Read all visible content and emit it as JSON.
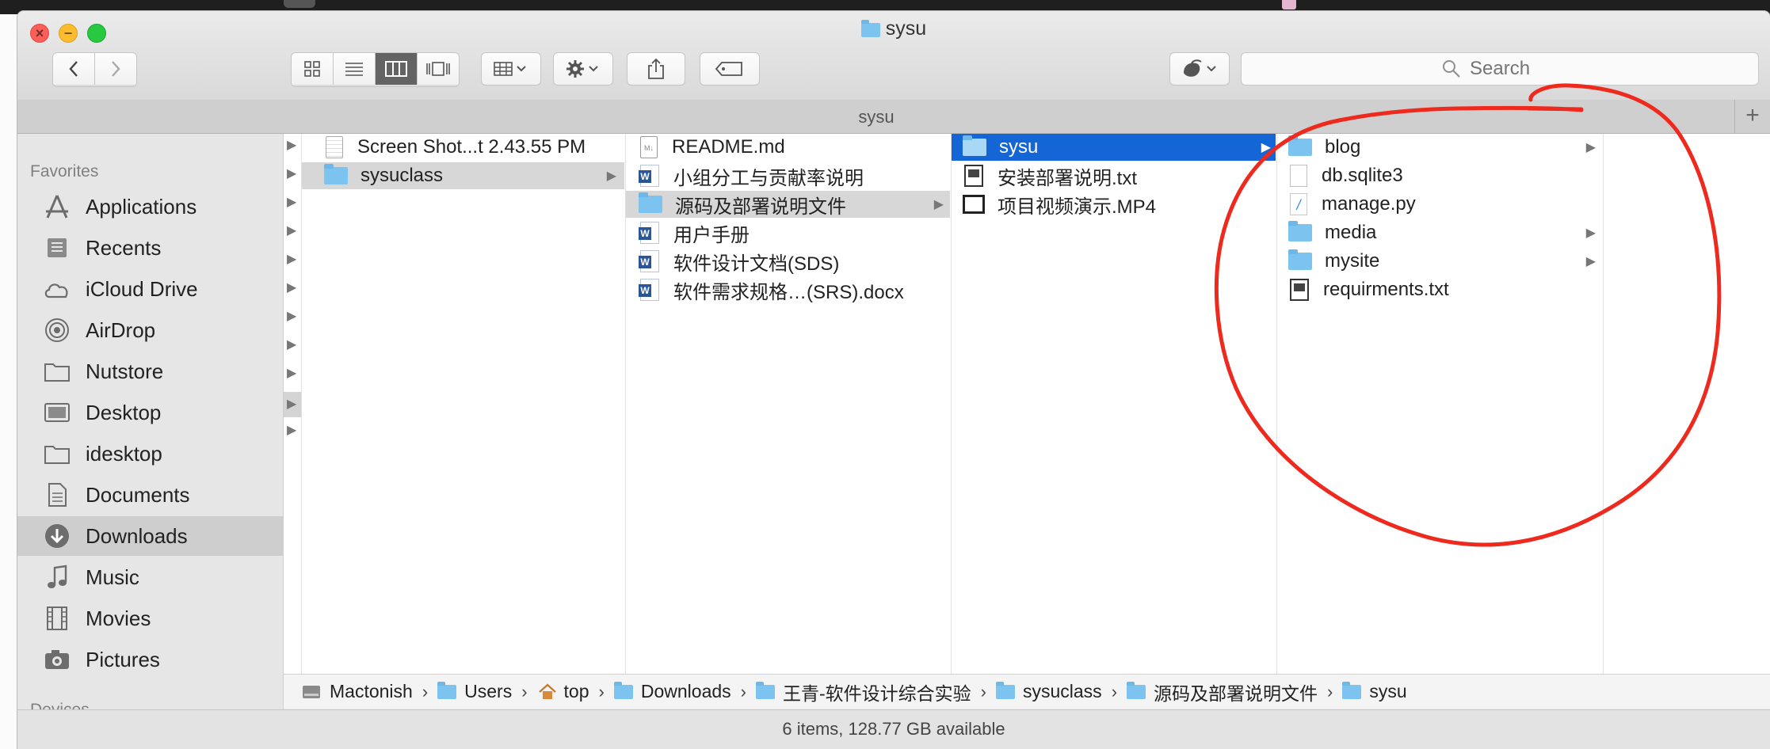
{
  "window": {
    "title": "sysu",
    "tab_title": "sysu"
  },
  "toolbar": {
    "back_icon": "chevron-left-icon",
    "forward_icon": "chevron-right-icon",
    "search_placeholder": "Search"
  },
  "sidebar": {
    "favorites_header": "Favorites",
    "devices_header": "Devices",
    "items": [
      {
        "label": "Applications",
        "icon": "applications-icon"
      },
      {
        "label": "Recents",
        "icon": "recents-icon"
      },
      {
        "label": "iCloud Drive",
        "icon": "cloud-icon"
      },
      {
        "label": "AirDrop",
        "icon": "airdrop-icon"
      },
      {
        "label": "Nutstore",
        "icon": "folder-icon"
      },
      {
        "label": "Desktop",
        "icon": "desktop-icon"
      },
      {
        "label": "idesktop",
        "icon": "folder-icon"
      },
      {
        "label": "Documents",
        "icon": "documents-icon"
      },
      {
        "label": "Downloads",
        "icon": "downloads-icon"
      },
      {
        "label": "Music",
        "icon": "music-icon"
      },
      {
        "label": "Movies",
        "icon": "movies-icon"
      },
      {
        "label": "Pictures",
        "icon": "pictures-icon"
      }
    ],
    "selected": "Downloads"
  },
  "columns": {
    "col1": [
      {
        "name": "Screen Shot...t 2.43.55 PM",
        "kind": "image"
      },
      {
        "name": "sysuclass",
        "kind": "folder",
        "highlight": true
      }
    ],
    "col2": [
      {
        "name": "README.md",
        "kind": "md"
      },
      {
        "name": "小组分工与贡献率说明",
        "kind": "word"
      },
      {
        "name": "源码及部署说明文件",
        "kind": "folder",
        "highlight": true
      },
      {
        "name": "用户手册",
        "kind": "word"
      },
      {
        "name": "软件设计文档(SDS)",
        "kind": "word"
      },
      {
        "name": "软件需求规格…(SRS).docx",
        "kind": "word"
      }
    ],
    "col3": [
      {
        "name": "sysu",
        "kind": "folder",
        "selected": true
      },
      {
        "name": "安装部署说明.txt",
        "kind": "txt"
      },
      {
        "name": "项目视频演示.MP4",
        "kind": "movie"
      }
    ],
    "col4": [
      {
        "name": "blog",
        "kind": "folder"
      },
      {
        "name": "db.sqlite3",
        "kind": "db"
      },
      {
        "name": "manage.py",
        "kind": "py"
      },
      {
        "name": "media",
        "kind": "folder"
      },
      {
        "name": "mysite",
        "kind": "folder"
      },
      {
        "name": "requirments.txt",
        "kind": "txt"
      }
    ]
  },
  "pathbar": [
    "Mactonish",
    "Users",
    "top",
    "Downloads",
    "王青-软件设计综合实验",
    "sysuclass",
    "源码及部署说明文件",
    "sysu"
  ],
  "status": "6 items, 128.77 GB available",
  "annotation_color": "#ee2a1e"
}
